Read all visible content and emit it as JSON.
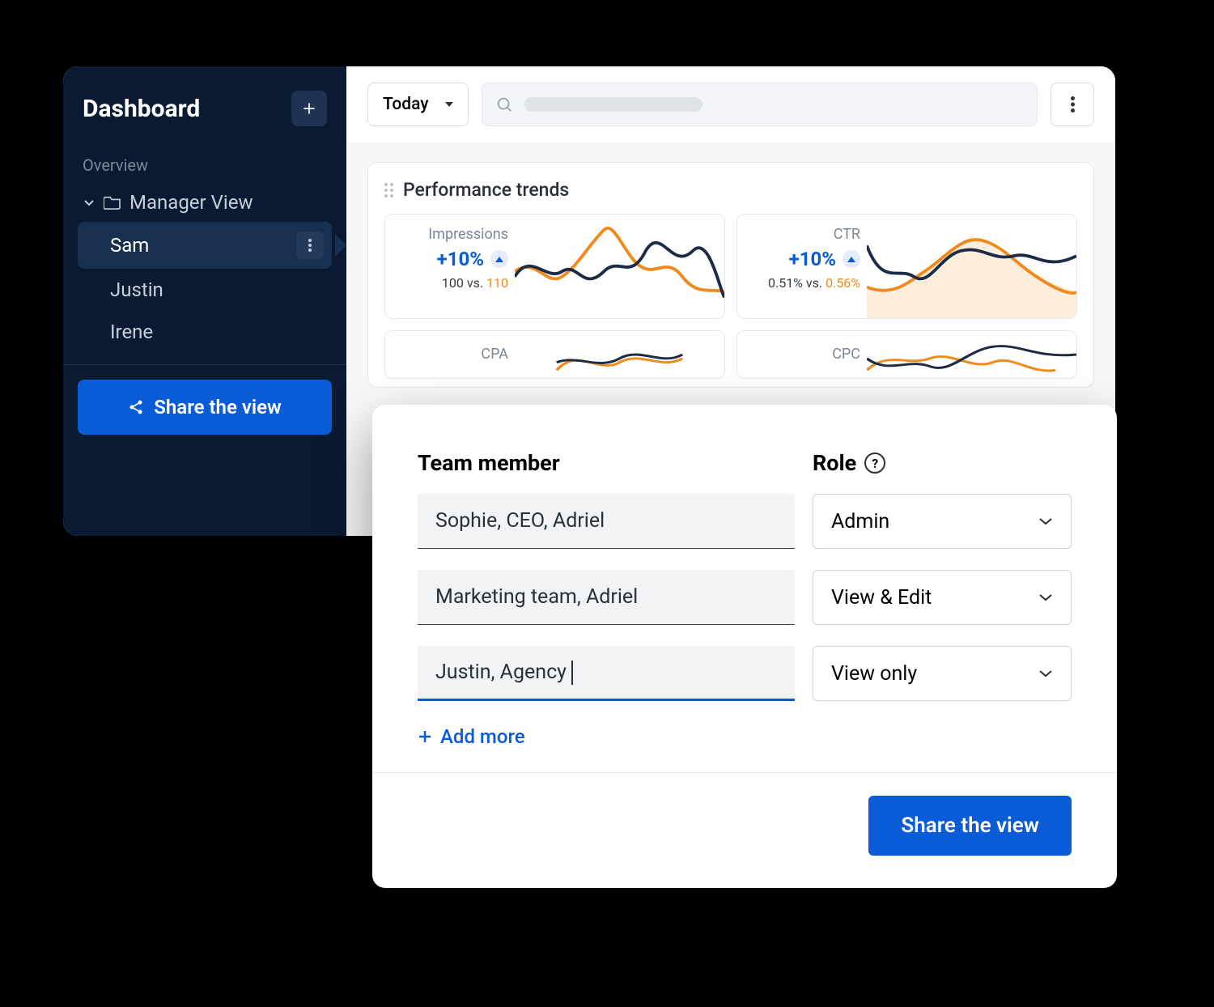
{
  "sidebar": {
    "title": "Dashboard",
    "overview_label": "Overview",
    "folder_label": "Manager View",
    "items": [
      {
        "label": "Sam",
        "active": true
      },
      {
        "label": "Justin",
        "active": false
      },
      {
        "label": "Irene",
        "active": false
      }
    ],
    "share_label": "Share the view"
  },
  "toolbar": {
    "range_label": "Today"
  },
  "trends": {
    "title": "Performance trends",
    "cards": [
      {
        "name": "Impressions",
        "delta": "+10%",
        "a": "100",
        "b": "110",
        "sep": " vs. "
      },
      {
        "name": "CTR",
        "delta": "+10%",
        "a": "0.51%",
        "b": "0.56%",
        "sep": " vs. "
      },
      {
        "name": "CPA"
      },
      {
        "name": "CPC"
      }
    ]
  },
  "modal": {
    "member_header": "Team member",
    "role_header": "Role",
    "rows": [
      {
        "member": "Sophie, CEO, Adriel",
        "role": "Admin"
      },
      {
        "member": "Marketing team, Adriel",
        "role": "View & Edit"
      },
      {
        "member": "Justin, Agency ",
        "role": "View only",
        "focus": true
      }
    ],
    "add_more_label": "Add more",
    "submit_label": "Share the view"
  },
  "chart_data": [
    {
      "type": "line",
      "title": "Impressions",
      "series": [
        {
          "name": "current",
          "color": "#1d2b46",
          "values": [
            40,
            60,
            35,
            55,
            30,
            65,
            45,
            75,
            50,
            60,
            30
          ]
        },
        {
          "name": "previous",
          "color": "#f08a1d",
          "values": [
            55,
            45,
            30,
            40,
            50,
            85,
            55,
            45,
            60,
            35,
            25
          ]
        }
      ],
      "ylim": [
        0,
        100
      ]
    },
    {
      "type": "line",
      "title": "CTR",
      "series": [
        {
          "name": "current",
          "color": "#1d2b46",
          "values": [
            70,
            30,
            45,
            35,
            55,
            60,
            70,
            55,
            60,
            45,
            60
          ]
        },
        {
          "name": "previous",
          "color": "#f08a1d",
          "values": [
            30,
            25,
            35,
            50,
            70,
            80,
            65,
            50,
            40,
            30,
            25
          ]
        }
      ],
      "ylim": [
        0,
        100
      ]
    },
    {
      "type": "line",
      "title": "CPA",
      "series": [
        {
          "name": "current",
          "color": "#1d2b46",
          "values": [
            50,
            60,
            40,
            55
          ]
        },
        {
          "name": "previous",
          "color": "#f08a1d",
          "values": [
            40,
            70,
            45,
            50
          ]
        }
      ],
      "ylim": [
        0,
        100
      ]
    },
    {
      "type": "line",
      "title": "CPC",
      "series": [
        {
          "name": "current",
          "color": "#1d2b46",
          "values": [
            55,
            35,
            50,
            35,
            60,
            70,
            55
          ]
        },
        {
          "name": "previous",
          "color": "#f08a1d",
          "values": [
            30,
            60,
            40,
            55,
            45,
            35,
            30
          ]
        }
      ],
      "ylim": [
        0,
        100
      ]
    }
  ]
}
